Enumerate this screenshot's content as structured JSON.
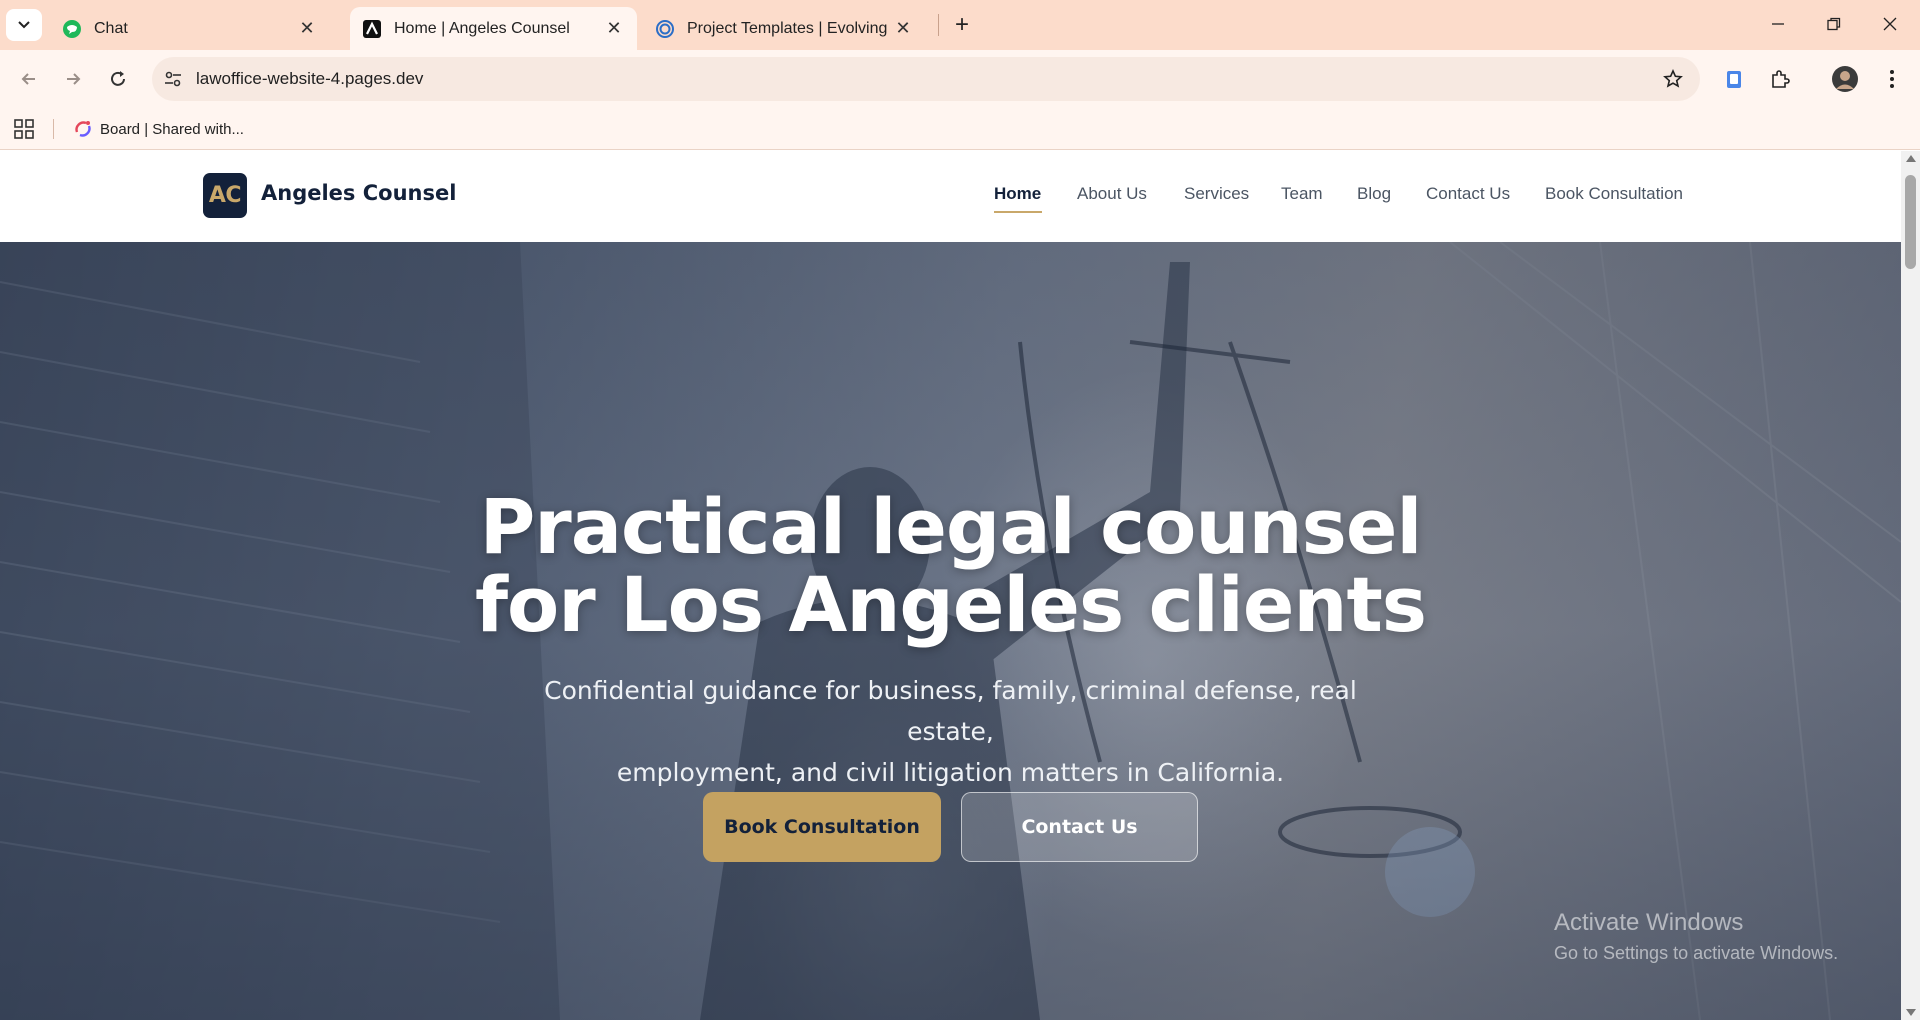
{
  "browser": {
    "tabs": [
      {
        "title": "Chat",
        "favicon": "chat-bubble-icon",
        "active": false
      },
      {
        "title": "Home | Angeles Counsel",
        "favicon": "angeles-counsel-logo-icon",
        "active": true
      },
      {
        "title": "Project Templates | Evolving Cyb",
        "favicon": "spiral-icon",
        "active": false
      }
    ],
    "url": "lawoffice-website-4.pages.dev",
    "bookmarks": [
      {
        "label": "Board | Shared with...",
        "favicon": "board-icon"
      }
    ],
    "accent_color": "#fcdccb"
  },
  "site": {
    "logo_initials": "AC",
    "logo_name": "Angeles Counsel",
    "nav": [
      {
        "label": "Home",
        "active": true
      },
      {
        "label": "About Us",
        "active": false
      },
      {
        "label": "Services",
        "active": false
      },
      {
        "label": "Team",
        "active": false
      },
      {
        "label": "Blog",
        "active": false
      },
      {
        "label": "Contact Us",
        "active": false
      },
      {
        "label": "Book Consultation",
        "active": false
      }
    ],
    "hero": {
      "title_line1": "Practical legal counsel",
      "title_line2": "for Los Angeles clients",
      "subtitle_line1": "Confidential guidance for business, family, criminal defense, real estate,",
      "subtitle_line2": "employment, and civil litigation matters in California.",
      "primary_cta": "Book Consultation",
      "secondary_cta": "Contact Us"
    },
    "brand_navy": "#13213a",
    "brand_gold": "#c4a261"
  },
  "os_watermark": {
    "title": "Activate Windows",
    "subtitle": "Go to Settings to activate Windows."
  }
}
